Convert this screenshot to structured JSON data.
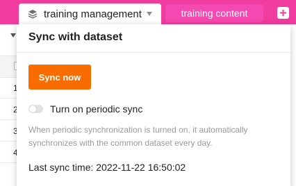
{
  "tabs": {
    "active_label": "training management",
    "other_label": "training content"
  },
  "background_rows": [
    "1",
    "2",
    "3",
    "4"
  ],
  "popover": {
    "title": "Sync with dataset",
    "sync_button_label": "Sync now",
    "periodic_toggle": {
      "label": "Turn on periodic sync",
      "checked": false
    },
    "description": "When periodic synchronization is turned on, it automatically synchronizes with the common dataset every day.",
    "last_sync": "Last sync time: 2022-11-22 16:50:02"
  },
  "colors": {
    "topbar": "#ef3c9e",
    "inactive_tab": "#f548b0",
    "sync_button": "#f96d00"
  },
  "icons": {
    "tab": "layers-icon",
    "tab_dropdown": "caret-down-icon",
    "add": "plus-icon"
  }
}
